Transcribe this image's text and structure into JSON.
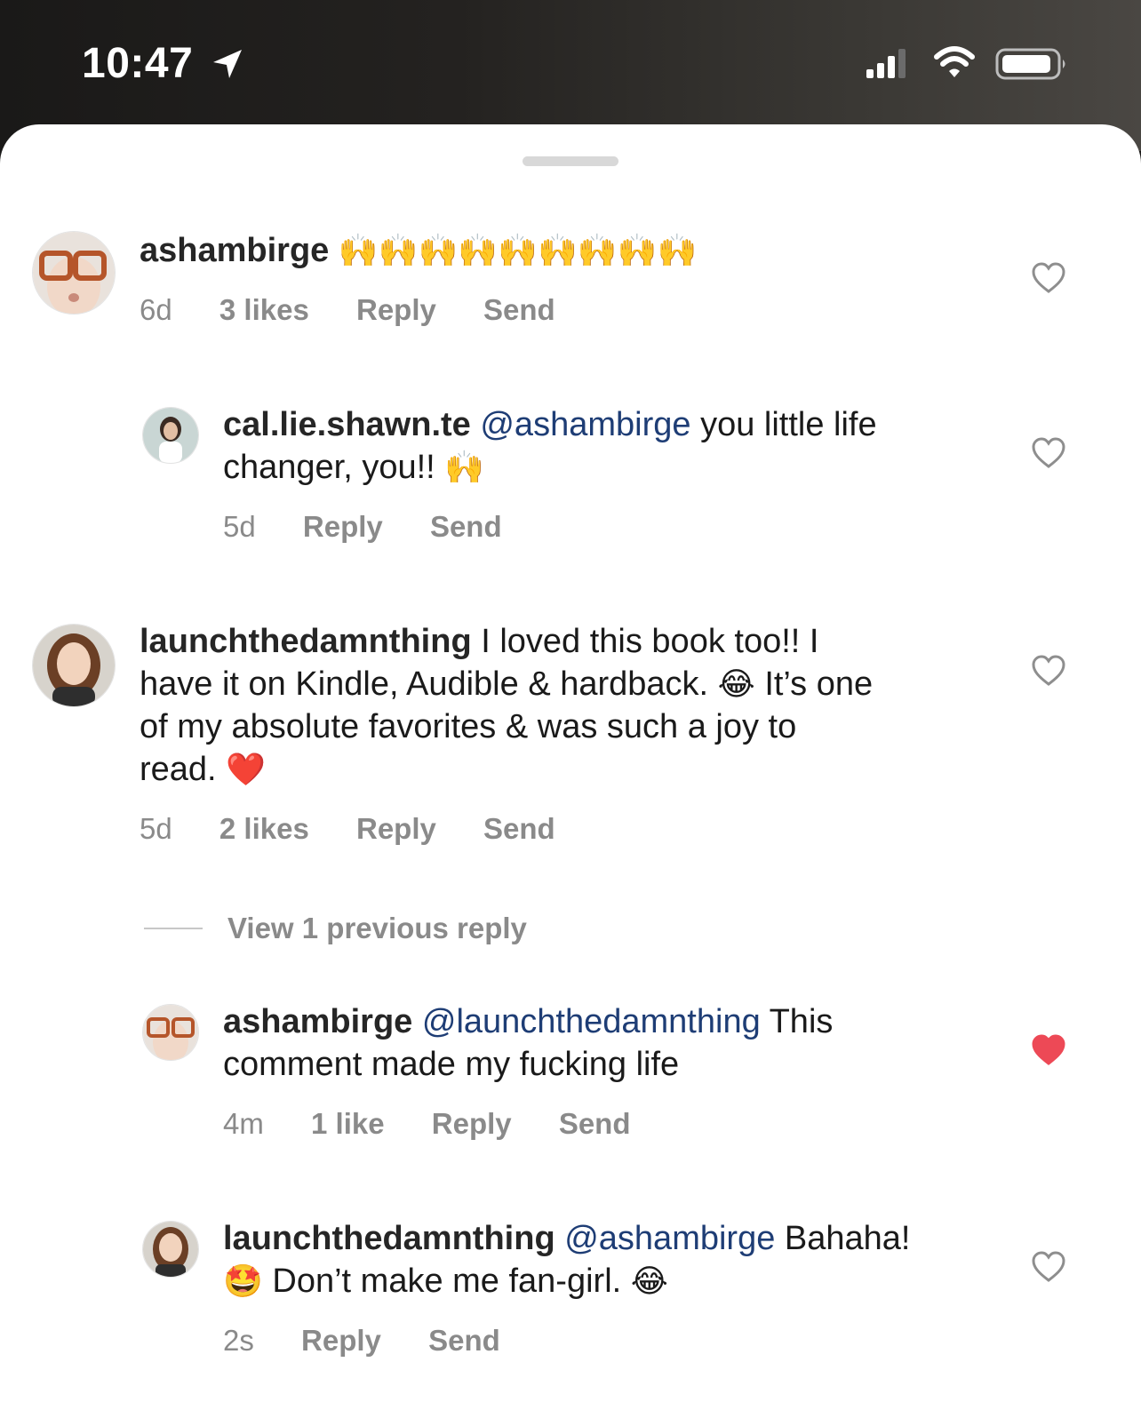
{
  "status_bar": {
    "time": "10:47",
    "icons": [
      "location-arrow-icon",
      "cellular-signal-icon",
      "wifi-icon",
      "battery-icon"
    ]
  },
  "comments": [
    {
      "username": "ashambirge",
      "body": "",
      "emoji": "🙌🙌🙌🙌🙌🙌🙌🙌🙌",
      "time": "6d",
      "likes": "3 likes",
      "reply": "Reply",
      "send": "Send",
      "liked": false
    },
    {
      "username": "cal.lie.shawn.te",
      "mention": "@ashambirge",
      "body_1": "you little life",
      "body_2": "changer, you!!",
      "emoji": "🙌",
      "time": "5d",
      "reply": "Reply",
      "send": "Send",
      "liked": false
    },
    {
      "username": "launchthedamnthing",
      "body_1": "I loved this book too!! I",
      "body_2": "have it on Kindle, Audible & hardback.",
      "emoji_1": "😂",
      "body_3": "It’s one",
      "body_4": "of my absolute favorites & was such a joy to",
      "body_5": "read.",
      "emoji_2": "❤️",
      "time": "5d",
      "likes": "2 likes",
      "reply": "Reply",
      "send": "Send",
      "liked": false
    },
    {
      "username": "ashambirge",
      "mention": "@launchthedamnthing",
      "body_1": "This",
      "body_2": "comment made my fucking life",
      "time": "4m",
      "likes": "1 like",
      "reply": "Reply",
      "send": "Send",
      "liked": true
    },
    {
      "username": "launchthedamnthing",
      "mention": "@ashambirge",
      "body_1": "Bahaha!",
      "emoji_1": "🤩",
      "body_2": "Don’t make me fan-girl.",
      "emoji_2": "😂",
      "time": "2s",
      "reply": "Reply",
      "send": "Send",
      "liked": false
    }
  ],
  "view_previous": "View 1 previous reply",
  "colors": {
    "mention": "#1e3d75",
    "meta": "#8a8a8a",
    "liked_heart": "#ed4956"
  }
}
